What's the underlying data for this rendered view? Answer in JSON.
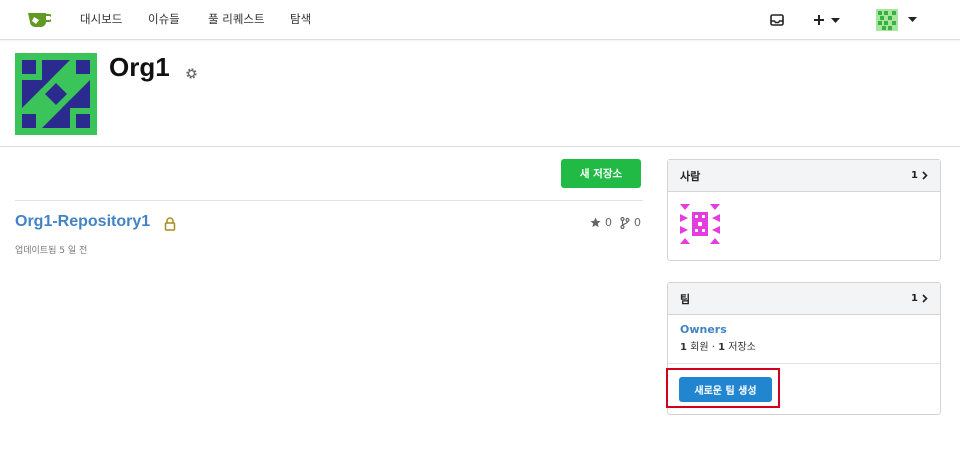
{
  "nav": {
    "items": [
      "대시보드",
      "이슈들",
      "풀 리퀘스트",
      "탐색"
    ]
  },
  "org": {
    "name": "Org1"
  },
  "repos": {
    "new_button": "새 저장소",
    "list": [
      {
        "name": "Org1-Repository1",
        "stars": "0",
        "forks": "0",
        "updated": "업데이트됨 5 일 전"
      }
    ]
  },
  "people": {
    "title": "사람",
    "count": "1"
  },
  "teams": {
    "title": "팀",
    "count": "1",
    "items": [
      {
        "name": "Owners",
        "members": "1",
        "members_label": "회원",
        "sep": " · ",
        "repos": "1",
        "repos_label": "저장소"
      }
    ],
    "create_button": "새로운 팀 생성"
  },
  "colors": {
    "accent": "#4183c4",
    "green_button": "#21ba45",
    "blue_button": "#2185d0",
    "highlight": "#d0021b"
  }
}
